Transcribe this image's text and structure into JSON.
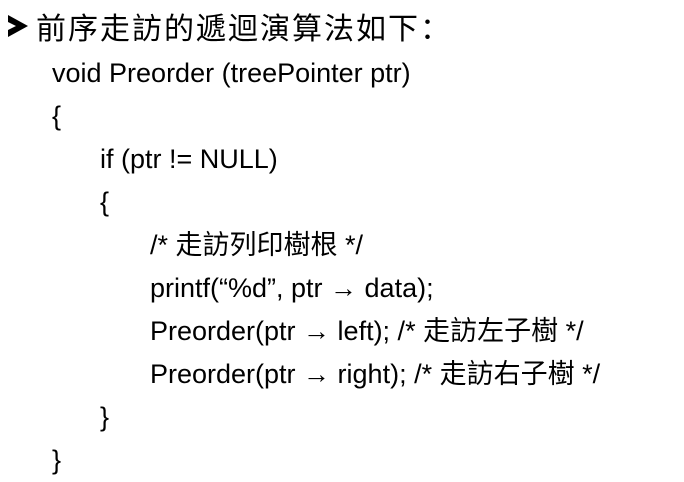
{
  "heading": {
    "text": "前序走訪的遞迴演算法如下："
  },
  "code_lines": [
    {
      "indent": 0,
      "segments": [
        "void Preorder (treePointer ptr)"
      ]
    },
    {
      "indent": 0,
      "segments": [
        "{"
      ]
    },
    {
      "indent": 1,
      "segments": [
        "if (ptr != NULL)"
      ]
    },
    {
      "indent": 1,
      "segments": [
        "{"
      ]
    },
    {
      "indent": 2,
      "segments": [
        "/* ",
        "走訪列印樹根",
        " */"
      ]
    },
    {
      "indent": 2,
      "segments": [
        "printf(“%d”, ptr → data);"
      ]
    },
    {
      "indent": 2,
      "segments": [
        "Preorder(ptr → left); /* ",
        "走訪左子樹",
        " */"
      ]
    },
    {
      "indent": 2,
      "segments": [
        "Preorder(ptr → right); /* ",
        "走訪右子樹",
        " */"
      ]
    },
    {
      "indent": 1,
      "segments": [
        "}"
      ]
    },
    {
      "indent": 0,
      "segments": [
        "}"
      ]
    }
  ],
  "icons": {
    "bullet": "arrowhead-bullet-icon"
  }
}
